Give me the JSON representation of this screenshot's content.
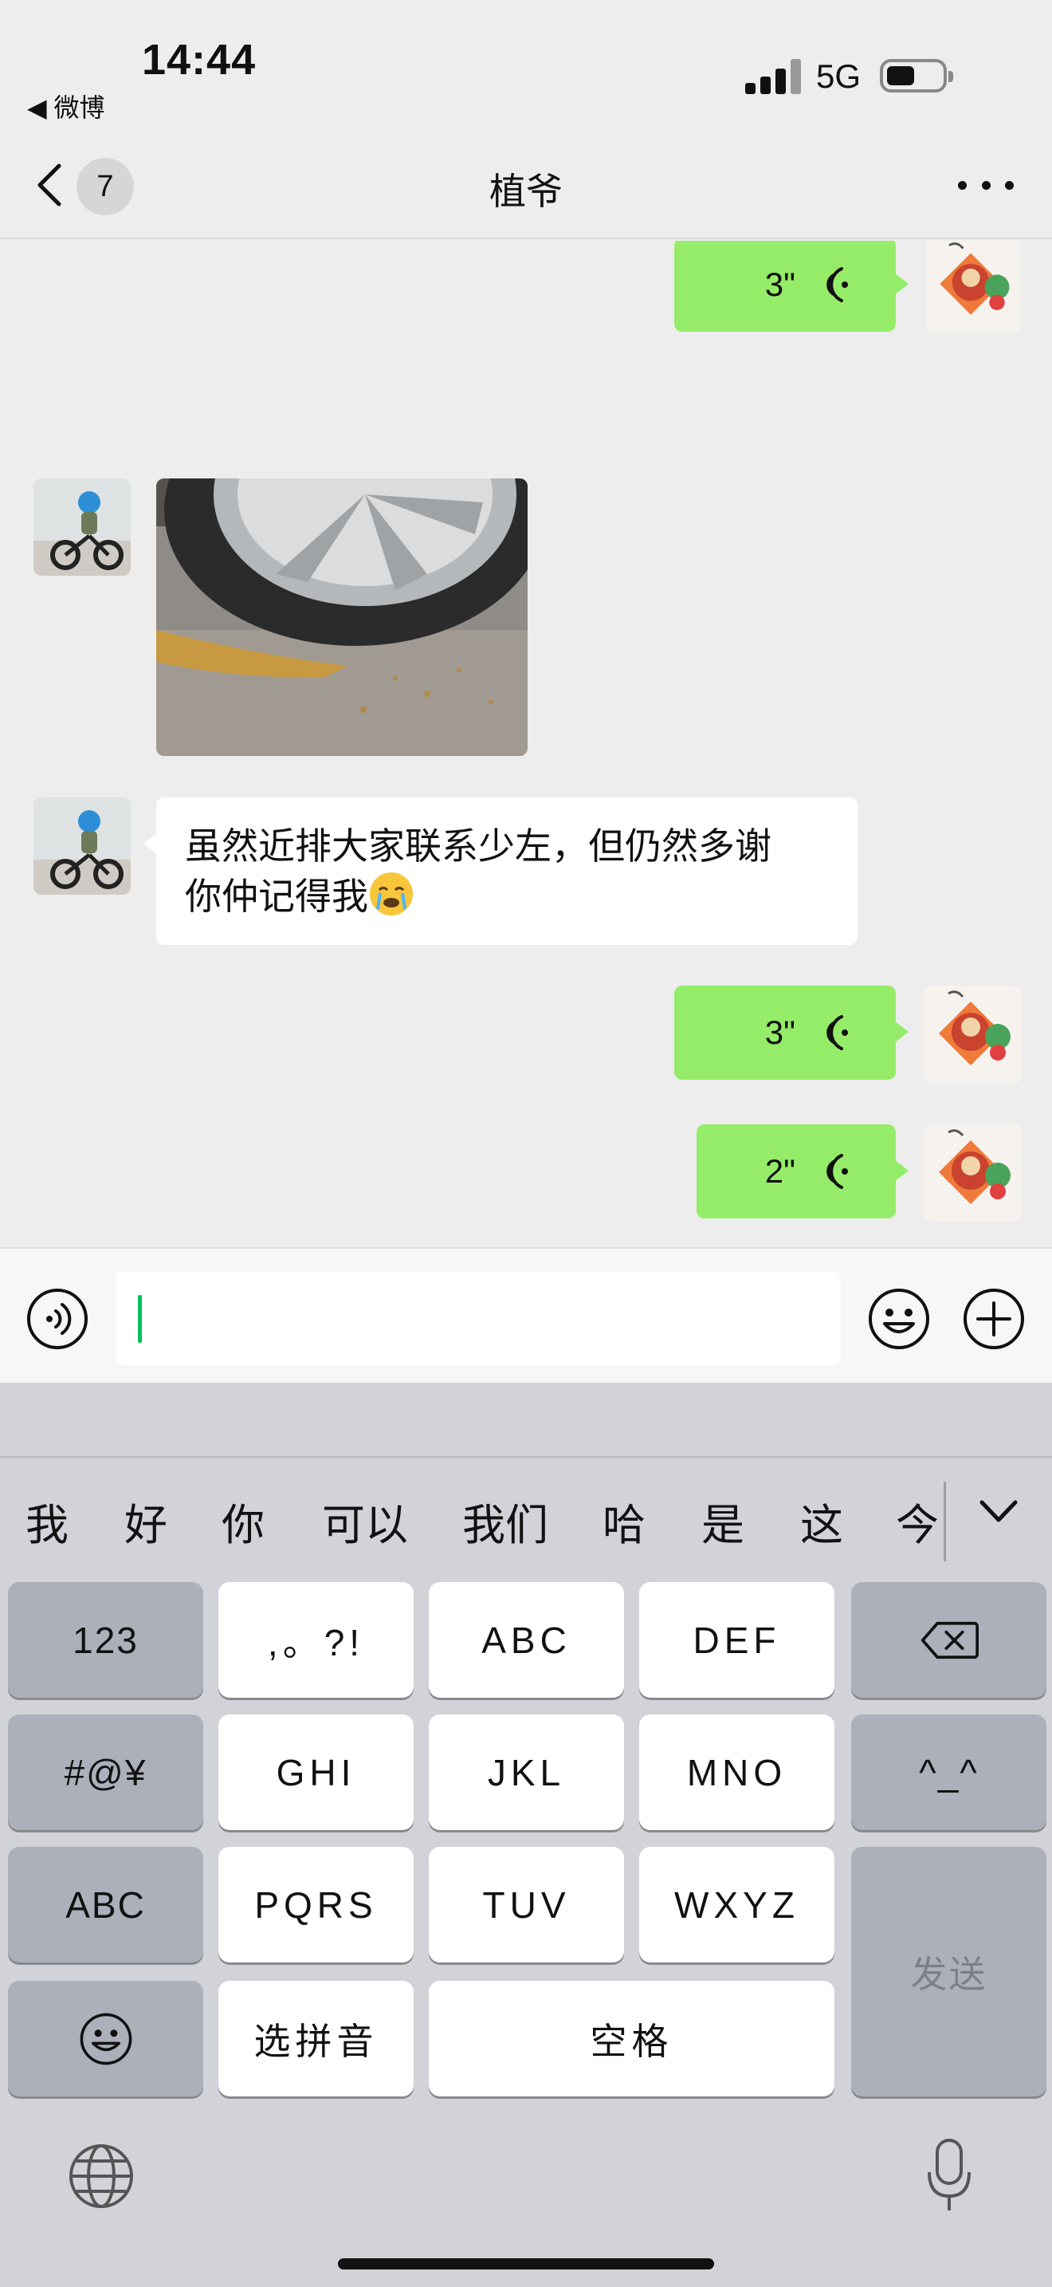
{
  "status_bar": {
    "time": "14:44",
    "back_app": "◀ 微博",
    "network": "5G"
  },
  "nav": {
    "unread_count": "7",
    "title": "植爷"
  },
  "messages": [
    {
      "type": "voice",
      "side": "right",
      "duration": "3\""
    },
    {
      "type": "image",
      "side": "left"
    },
    {
      "type": "text",
      "side": "left",
      "text_line1": "虽然近排大家联系少左，但仍然多谢",
      "text_line2": "你仲记得我"
    },
    {
      "type": "voice",
      "side": "right",
      "duration": "3\""
    },
    {
      "type": "voice",
      "side": "right",
      "duration": "2\""
    }
  ],
  "input": {
    "value": ""
  },
  "keyboard": {
    "candidates": [
      "我",
      "好",
      "你",
      "可以",
      "我们",
      "哈",
      "是",
      "这",
      "今"
    ],
    "keys": {
      "num": "123",
      "punct": ",。?!",
      "abc_key": "ABC",
      "def": "DEF",
      "symbols": "#@¥",
      "ghi": "GHI",
      "jkl": "JKL",
      "mno": "MNO",
      "face": "^_^",
      "abc_switch": "ABC",
      "pqrs": "PQRS",
      "tuv": "TUV",
      "wxyz": "WXYZ",
      "send": "发送",
      "pinyin": "选拼音",
      "space": "空格"
    }
  },
  "colors": {
    "voice_bubble": "#95ec69",
    "caret": "#07c160",
    "background": "#ededed"
  }
}
